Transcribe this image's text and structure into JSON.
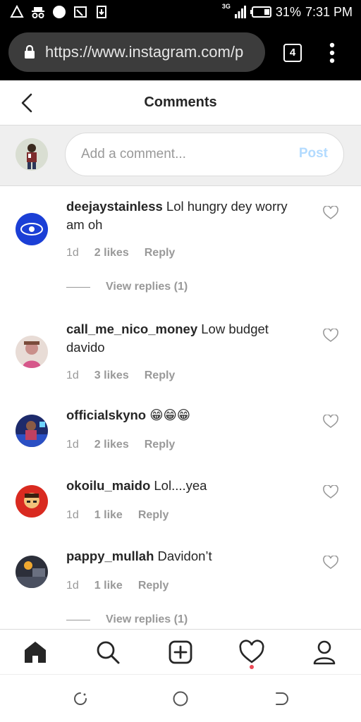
{
  "status_bar": {
    "network": "3G",
    "battery": "31%",
    "time": "7:31 PM"
  },
  "browser": {
    "url": "https://www.instagram.com/p",
    "tab_count": "4"
  },
  "header": {
    "title": "Comments"
  },
  "compose": {
    "placeholder": "Add a comment...",
    "post_label": "Post"
  },
  "comments": [
    {
      "username": "deejaystainless",
      "text": "Lol hungry dey worry am oh",
      "age": "1d",
      "likes": "2 likes",
      "reply": "Reply",
      "view_replies": "View replies (1)"
    },
    {
      "username": "call_me_nico_money",
      "text": "Low budget davido",
      "age": "1d",
      "likes": "3 likes",
      "reply": "Reply"
    },
    {
      "username": "officialskyno",
      "text": "😁😁😁",
      "age": "1d",
      "likes": "2 likes",
      "reply": "Reply"
    },
    {
      "username": "okoilu_maido",
      "text": "Lol....yea",
      "age": "1d",
      "likes": "1 like",
      "reply": "Reply"
    },
    {
      "username": "pappy_mullah",
      "text": "Davidon’t",
      "age": "1d",
      "likes": "1 like",
      "reply": "Reply",
      "view_replies": "View replies (1)"
    }
  ],
  "bottom_nav": [
    "home-icon",
    "search-icon",
    "new-post-icon",
    "activity-icon",
    "profile-icon"
  ],
  "colors": {
    "post_disabled": "#b3dbff",
    "notification_dot": "#ed4956",
    "muted_text": "#999999"
  }
}
